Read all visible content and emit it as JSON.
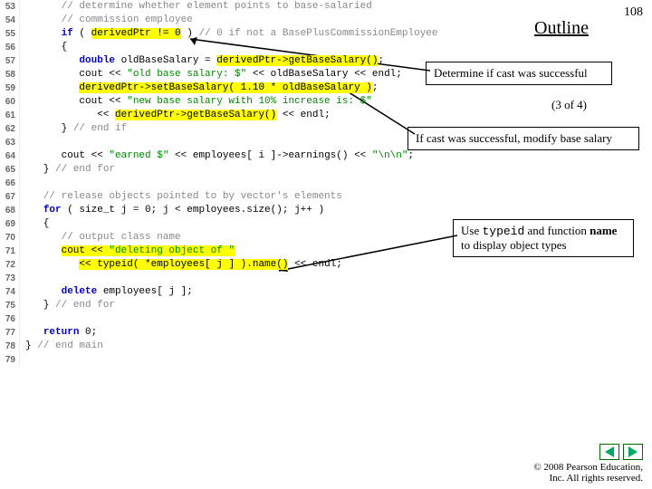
{
  "header": {
    "outline": "Outline",
    "page_number": "108",
    "progress": "(3 of 4)"
  },
  "annotations": {
    "a1": "Determine if cast was successful",
    "a2": "If cast was successful, modify base salary",
    "a3_pre": "Use ",
    "a3_code": "typeid",
    "a3_mid": " and function ",
    "a3_name": "name",
    "a3_post": " to display object types"
  },
  "code": {
    "l53": "      // determine whether element points to base-salaried",
    "l54": "      // commission employee",
    "l55a": "      ",
    "l55kw": "if",
    "l55b": " ( ",
    "l55hl": "derivedPtr != 0",
    "l55c": " ) ",
    "l55cm": "// 0 if not a BasePlusCommissionEmployee",
    "l56": "      {",
    "l57a": "         ",
    "l57kw": "double",
    "l57b": " oldBaseSalary = ",
    "l57hl": "derivedPtr->getBaseSalary()",
    "l57c": ";",
    "l58a": "         cout << ",
    "l58s": "\"old base salary: $\"",
    "l58b": " << oldBaseSalary << endl;",
    "l59a": "         ",
    "l59hl": "derivedPtr->setBaseSalary( 1.10 * oldBaseSalary )",
    "l59b": ";",
    "l60a": "         cout << ",
    "l60s": "\"new base salary with 10% increase is: $\"",
    "l61a": "            << ",
    "l61hl": "derivedPtr->getBaseSalary()",
    "l61b": " << endl;",
    "l62a": "      } ",
    "l62cm": "// end if",
    "l63": "",
    "l64a": "      cout << ",
    "l64s1": "\"earned $\"",
    "l64b": " << employees[ i ]->earnings() << ",
    "l64s2": "\"\\n\\n\"",
    "l64c": ";",
    "l65a": "   } ",
    "l65cm": "// end for",
    "l66": "",
    "l67cm": "   // release objects pointed to by vector's elements",
    "l68a": "   ",
    "l68kw": "for",
    "l68b": " ( size_t j = 0; j < employees.size(); j++ )",
    "l69": "   {",
    "l70cm": "      // output class name",
    "l71a": "      ",
    "l71hl1": "cout << ",
    "l71hl2": "\"deleting object of \"",
    "l72a": "         ",
    "l72hl": "<< typeid( *employees[ j ] ).name()",
    "l72b": " << endl;",
    "l73": "",
    "l74a": "      ",
    "l74kw": "delete",
    "l74b": " employees[ j ];",
    "l75a": "   } ",
    "l75cm": "// end for",
    "l76": "",
    "l77a": "   ",
    "l77kw": "return",
    "l77b": " 0;",
    "l78a": "} ",
    "l78cm": "// end main"
  },
  "footer": {
    "copyright": "© 2008 Pearson Education,",
    "rights": "Inc.  All rights reserved."
  }
}
